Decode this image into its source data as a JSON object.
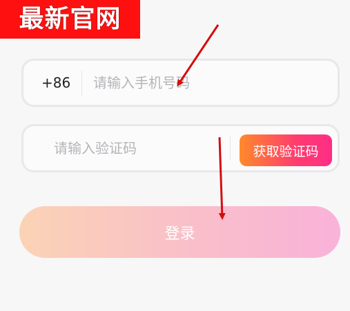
{
  "banner": {
    "text": "最新官网"
  },
  "phone": {
    "prefix": "+86",
    "placeholder": "请输入手机号码"
  },
  "code": {
    "placeholder": "请输入验证码",
    "button_label": "获取验证码"
  },
  "login": {
    "label": "登录"
  },
  "colors": {
    "banner_bg": "#ff1010",
    "code_button_gradient": [
      "#ff8a2a",
      "#ff2d86"
    ],
    "login_gradient": [
      "#fbd3b5",
      "#f9b2d9"
    ],
    "arrow": "#d40d0d"
  }
}
